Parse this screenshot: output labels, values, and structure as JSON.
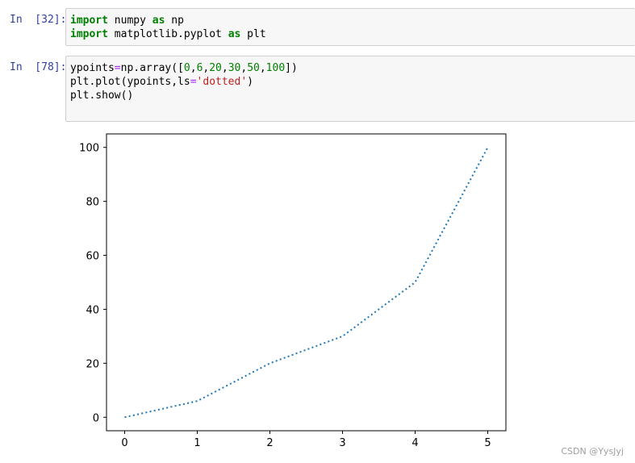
{
  "cells": [
    {
      "prompt": "In  [32]:",
      "lines": [
        [
          {
            "t": "import",
            "c": "kw"
          },
          {
            "t": " numpy "
          },
          {
            "t": "as",
            "c": "kw"
          },
          {
            "t": " np"
          }
        ],
        [
          {
            "t": "import",
            "c": "kw"
          },
          {
            "t": " matplotlib.pyplot "
          },
          {
            "t": "as",
            "c": "kw"
          },
          {
            "t": " plt"
          }
        ]
      ]
    },
    {
      "prompt": "In  [78]:",
      "lines": [
        [
          {
            "t": "ypoints"
          },
          {
            "t": "=",
            "c": "op"
          },
          {
            "t": "np.array(["
          },
          {
            "t": "0",
            "c": "num"
          },
          {
            "t": ","
          },
          {
            "t": "6",
            "c": "num"
          },
          {
            "t": ","
          },
          {
            "t": "20",
            "c": "num"
          },
          {
            "t": ","
          },
          {
            "t": "30",
            "c": "num"
          },
          {
            "t": ","
          },
          {
            "t": "50",
            "c": "num"
          },
          {
            "t": ","
          },
          {
            "t": "100",
            "c": "num"
          },
          {
            "t": "])"
          }
        ],
        [
          {
            "t": "plt.plot(ypoints,ls"
          },
          {
            "t": "=",
            "c": "op"
          },
          {
            "t": "'dotted'",
            "c": "str"
          },
          {
            "t": ")"
          }
        ],
        [
          {
            "t": "plt.show()"
          }
        ]
      ]
    }
  ],
  "chart_data": {
    "type": "line",
    "x": [
      0,
      1,
      2,
      3,
      4,
      5
    ],
    "series": [
      {
        "values": [
          0,
          6,
          20,
          30,
          50,
          100
        ],
        "color": "#1f77b4",
        "linestyle": "dotted"
      }
    ],
    "xticks": [
      0,
      1,
      2,
      3,
      4,
      5
    ],
    "yticks": [
      0,
      20,
      40,
      60,
      80,
      100
    ],
    "xlim": [
      -0.25,
      5.25
    ],
    "ylim": [
      -5,
      105
    ],
    "title": "",
    "xlabel": "",
    "ylabel": "",
    "grid": false
  },
  "watermark": "CSDN @YysJyj"
}
